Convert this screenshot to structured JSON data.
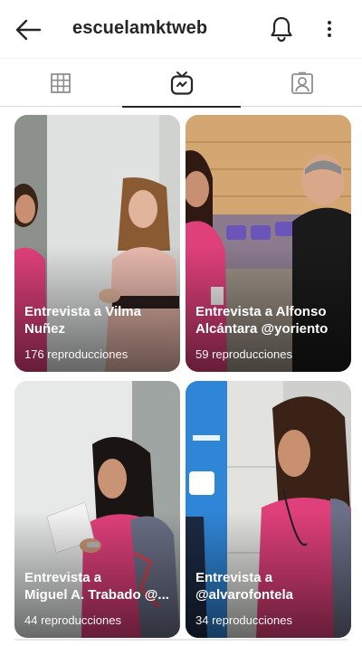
{
  "header": {
    "username": "escuelamktweb",
    "back_icon": "arrow-left-icon",
    "notifications_icon": "bell-icon",
    "more_icon": "more-vertical-icon"
  },
  "tabs": [
    {
      "name": "grid",
      "icon": "grid-icon",
      "active": false
    },
    {
      "name": "igtv",
      "icon": "igtv-icon",
      "active": true
    },
    {
      "name": "tagged",
      "icon": "tagged-person-icon",
      "active": false
    }
  ],
  "videos": [
    {
      "title_line1": "Entrevista a Vilma",
      "title_line2": "Nuñez",
      "views": "176 reproducciones"
    },
    {
      "title_line1": "Entrevista a Alfonso",
      "title_line2": "Alcántara @yoriento",
      "views": "59 reproducciones"
    },
    {
      "title_line1": "Entrevista a",
      "title_line2": "Miguel A. Trabado @...",
      "views": "44 reproducciones"
    },
    {
      "title_line1": "Entrevista a",
      "title_line2": "@alvarofontela",
      "views": "34 reproducciones"
    }
  ],
  "colors": {
    "text": "#262626",
    "divider": "#dbdbdb",
    "pink_shirt": "#e0407a"
  }
}
